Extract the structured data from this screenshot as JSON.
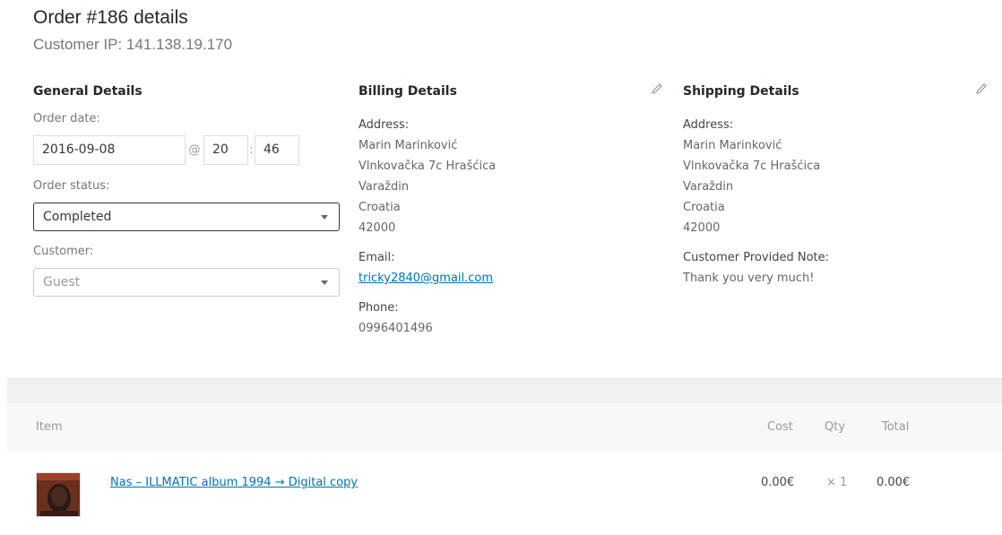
{
  "order": {
    "title": "Order #186 details",
    "customer_ip": "Customer IP: 141.138.19.170"
  },
  "general": {
    "heading": "General Details",
    "order_date_label": "Order date:",
    "date": "2016-09-08",
    "at": "@",
    "hour": "20",
    "colon": ":",
    "minute": "46",
    "order_status_label": "Order status:",
    "order_status": "Completed",
    "customer_label": "Customer:",
    "customer": "Guest"
  },
  "billing": {
    "heading": "Billing Details",
    "address_label": "Address:",
    "address": [
      "Marin Marinković",
      "Vlnkovačka 7c Hrašćica",
      "Varaždin",
      "Croatia",
      "42000"
    ],
    "email_label": "Email:",
    "email": "tricky2840@gmail.com",
    "phone_label": "Phone:",
    "phone": "0996401496"
  },
  "shipping": {
    "heading": "Shipping Details",
    "address_label": "Address:",
    "address": [
      "Marin Marinković",
      "Vlnkovačka 7c Hrašćica",
      "Varaždin",
      "Croatia",
      "42000"
    ],
    "note_label": "Customer Provided Note:",
    "note": "Thank you very much!"
  },
  "items_table": {
    "headers": {
      "item": "Item",
      "cost": "Cost",
      "qty": "Qty",
      "total": "Total"
    },
    "rows": [
      {
        "name": "Nas – ILLMATIC album 1994 → Digital copy",
        "cost": "0.00€",
        "qty": "× 1",
        "total": "0.00€"
      }
    ]
  },
  "icons": {
    "edit": "pencil-icon",
    "thumbnail": "album-cover-thumbnail"
  },
  "colors": {
    "link": "#0073aa",
    "heading": "#23282d",
    "muted": "#777777"
  }
}
